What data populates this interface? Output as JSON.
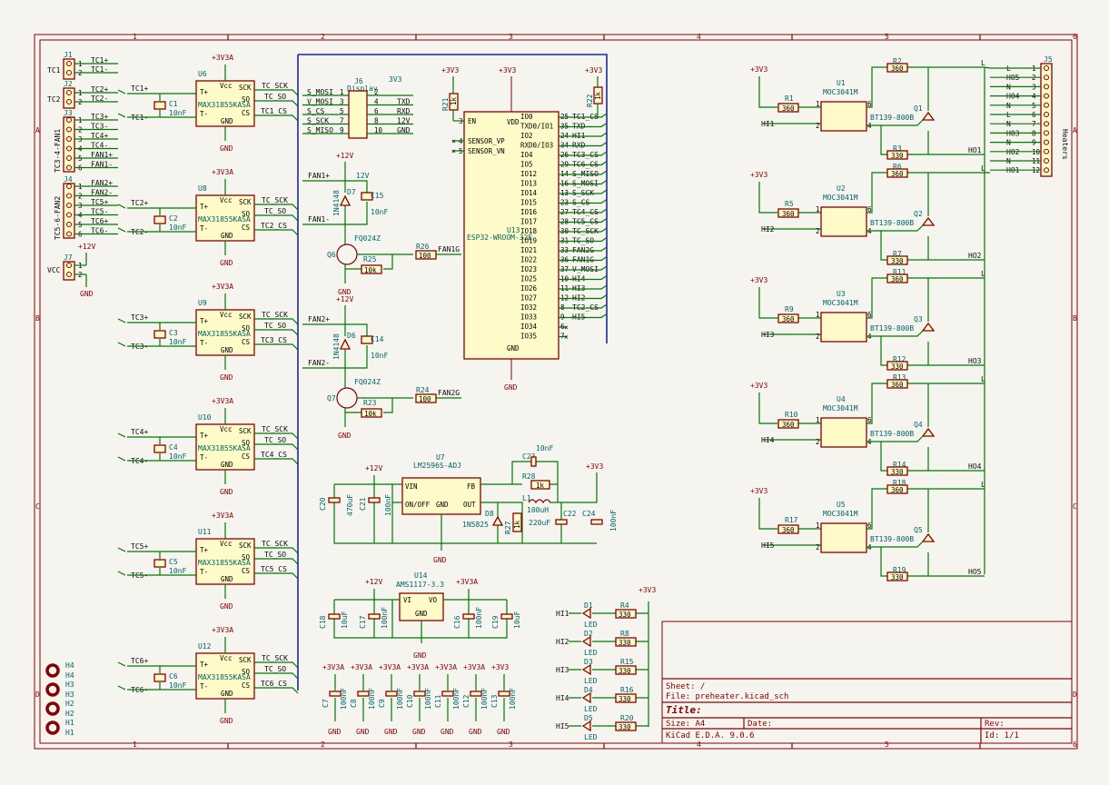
{
  "title_block": {
    "sheet": "Sheet: /",
    "file": "File: preheater.kicad_sch",
    "title": "Title:",
    "size": "Size: A4",
    "date": "Date:",
    "rev": "Rev:",
    "tool": "KiCad E.D.A. 9.0.6",
    "id": "Id: 1/1"
  },
  "frame": {
    "cols": [
      "1",
      "2",
      "3",
      "4",
      "5",
      "6"
    ],
    "rows": [
      "A",
      "B",
      "C",
      "D"
    ]
  },
  "power": {
    "p3v3a": "+3V3A",
    "p3v3": "+3V3",
    "p12v": "+12V",
    "gnd": "GND",
    "v12": "12V"
  },
  "connectors": {
    "j1": {
      "ref": "J1",
      "side": "TC1",
      "pins": [
        "TC1+",
        "TC1-"
      ]
    },
    "j2": {
      "ref": "J2",
      "side": "TC2",
      "pins": [
        "TC2+",
        "TC2-"
      ]
    },
    "j3": {
      "ref": "J3",
      "side": "TC3-4-FAN1",
      "pins": [
        "TC3+",
        "TC3-",
        "TC4+",
        "TC4-",
        "FAN1+",
        "FAN1-"
      ]
    },
    "j4": {
      "ref": "J4",
      "side": "TC5-6-FAN2",
      "pins": [
        "FAN2+",
        "FAN2-",
        "TC5+",
        "TC5-",
        "TC6+",
        "TC6-"
      ]
    },
    "j7": {
      "ref": "J7",
      "side": "VCC"
    },
    "j5": {
      "ref": "J5",
      "side": "Heaters",
      "pins": [
        "L",
        "HO5",
        "N",
        "HO4",
        "N",
        "L",
        "N",
        "HO3",
        "N",
        "HO2",
        "N",
        "HO1"
      ]
    }
  },
  "max": [
    {
      "ref": "U6",
      "cap": "C1",
      "tp": "TC1+",
      "tm": "TC1-",
      "cs": "TC1_CS"
    },
    {
      "ref": "U8",
      "cap": "C2",
      "tp": "TC2+",
      "tm": "TC2-",
      "cs": "TC2_CS"
    },
    {
      "ref": "U9",
      "cap": "C3",
      "tp": "TC3+",
      "tm": "TC3-",
      "cs": "TC3_CS"
    },
    {
      "ref": "U10",
      "cap": "C4",
      "tp": "TC4+",
      "tm": "TC4-",
      "cs": "TC4_CS"
    },
    {
      "ref": "U11",
      "cap": "C5",
      "tp": "TC5+",
      "tm": "TC5-",
      "cs": "TC5_CS"
    },
    {
      "ref": "U12",
      "cap": "C6",
      "tp": "TC6+",
      "tm": "TC6-",
      "cs": "TC6_CS"
    }
  ],
  "max_common": {
    "part": "MAX31855KASA",
    "cap_val": "10nF",
    "pins_left": [
      "T+",
      "T-"
    ],
    "pins_right": [
      "SCK",
      "SO",
      "CS"
    ],
    "vcc": "Vcc",
    "gnd": "GND",
    "sck_net": "TC_SCK",
    "so_net": "TC_SO"
  },
  "display": {
    "ref": "J6",
    "name": "Display",
    "left": [
      "S_MOSI",
      "V_MOSI",
      "S_CS",
      "S_SCK",
      "S_MISO"
    ],
    "right": [
      "TXD",
      "RXD",
      "12V",
      "GND"
    ],
    "label_3v3": "3V3"
  },
  "esp": {
    "ref": "U13",
    "part": "ESP32-WROOM-32E",
    "left_pins": [
      "EN",
      "SENSOR_VP",
      "SENSOR_VN"
    ],
    "left_nums": [
      "3",
      "4",
      "5"
    ],
    "right_pins": [
      "IO0",
      "TXD0/IO1",
      "IO2",
      "RXD0/IO3",
      "IO4",
      "IO5",
      "IO12",
      "IO13",
      "IO14",
      "IO15",
      "IO16",
      "IO17",
      "IO18",
      "IO19",
      "IO21",
      "IO22",
      "IO23",
      "IO25",
      "IO26",
      "IO27",
      "IO32",
      "IO33",
      "IO34",
      "IO35"
    ],
    "right_nums": [
      "25",
      "35",
      "24",
      "34",
      "26",
      "29",
      "14",
      "16",
      "13",
      "23",
      "27",
      "28",
      "30",
      "31",
      "33",
      "36",
      "37",
      "10",
      "11",
      "12",
      "8",
      "9",
      "6",
      "7"
    ],
    "right_nets": [
      "TC1_CS",
      "TXD",
      "HI1",
      "RXD",
      "TC3_CS",
      "TC6_CS",
      "S_MISO",
      "S_MOSI",
      "S_SCK",
      "S_CS",
      "TC4_CS",
      "TC5_CS",
      "TC_SCK",
      "TC_SO",
      "FAN2G",
      "FAN1G",
      "V_MOSI",
      "HI4",
      "HI3",
      "HI2",
      "TC2_CS",
      "HI5",
      "",
      ""
    ],
    "vdd": "VDD",
    "gnd": "GND",
    "r21": "R21",
    "r21v": "1k",
    "r22": "R22",
    "r22v": "1k"
  },
  "fans": [
    {
      "plus": "FAN1+",
      "minus": "FAN1-",
      "d": "D7",
      "c": "C15",
      "q": "Q6",
      "rg": "R26",
      "rp": "R25",
      "gnet": "FAN1G"
    },
    {
      "plus": "FAN2+",
      "minus": "FAN2-",
      "d": "D6",
      "c": "C14",
      "q": "Q7",
      "rg": "R24",
      "rp": "R23",
      "gnet": "FAN2G"
    }
  ],
  "fan_common": {
    "dval": "1N4148",
    "cval": "10nF",
    "qval": "FQ024Z",
    "rgval": "100",
    "rpval": "10k"
  },
  "buck": {
    "ref": "U7",
    "part": "LM2596S-ADJ",
    "pins": [
      "VIN",
      "ON/OFF",
      "GND",
      "FB",
      "OUT"
    ],
    "c20": "C20",
    "c20v": "470uF",
    "c21": "C21",
    "c21v": "100nF",
    "c23": "C23",
    "c23v": "10nF",
    "r28": "R28",
    "r28v": "1k",
    "l1": "L1",
    "l1v": "100uH",
    "d8": "D8",
    "d8v": "1N5825",
    "r27": "R27",
    "r27v": "1k",
    "c22": "C22",
    "c22v": "220uF",
    "c24": "C24",
    "c24v": "100nF"
  },
  "ldo": {
    "ref": "U14",
    "part": "AMS1117-3.3",
    "pins": [
      "VI",
      "VO",
      "GND"
    ],
    "caps": [
      {
        "ref": "C18",
        "val": "10uF"
      },
      {
        "ref": "C17",
        "val": "100nF"
      },
      {
        "ref": "C16",
        "val": "100nF"
      },
      {
        "ref": "C19",
        "val": "10uF"
      }
    ]
  },
  "decoupling": [
    {
      "ref": "C7",
      "val": "100nF",
      "rail": "+3V3A"
    },
    {
      "ref": "C8",
      "val": "100nF",
      "rail": "+3V3A"
    },
    {
      "ref": "C9",
      "val": "100nF",
      "rail": "+3V3A"
    },
    {
      "ref": "C10",
      "val": "100nF",
      "rail": "+3V3A"
    },
    {
      "ref": "C11",
      "val": "100nF",
      "rail": "+3V3A"
    },
    {
      "ref": "C12",
      "val": "100nF",
      "rail": "+3V3A"
    },
    {
      "ref": "C13",
      "val": "100nF",
      "rail": "+3V3"
    }
  ],
  "leds": [
    {
      "net": "HI1",
      "d": "D1",
      "r": "R4"
    },
    {
      "net": "HI2",
      "d": "D2",
      "r": "R8"
    },
    {
      "net": "HI3",
      "d": "D3",
      "r": "R15"
    },
    {
      "net": "HI4",
      "d": "D4",
      "r": "R16"
    },
    {
      "net": "HI5",
      "d": "D5",
      "r": "R20"
    }
  ],
  "led_common": {
    "dval": "LED",
    "rval": "330"
  },
  "triacs": [
    {
      "u": "U1",
      "r_in": "R1",
      "r_g": "R2",
      "r_s": "R3",
      "q": "Q1",
      "hi": "HI1",
      "ho": "HO1"
    },
    {
      "u": "U2",
      "r_in": "R5",
      "r_g": "R6",
      "r_s": "R7",
      "q": "Q2",
      "hi": "HI2",
      "ho": "HO2"
    },
    {
      "u": "U3",
      "r_in": "R9",
      "r_g": "R11",
      "r_s": "R12",
      "q": "Q3",
      "hi": "HI3",
      "ho": "HO3"
    },
    {
      "u": "U4",
      "r_in": "R10",
      "r_g": "R13",
      "r_s": "R14",
      "q": "Q4",
      "hi": "HI4",
      "ho": "HO4"
    },
    {
      "u": "U5",
      "r_in": "R17",
      "r_g": "R18",
      "r_s": "R19",
      "q": "Q5",
      "hi": "HI5",
      "ho": "HO5"
    }
  ],
  "triac_common": {
    "opto": "MOC3041M",
    "triac": "BT139-800B",
    "rin_val": "360",
    "rg_val": "360",
    "rs_val": "330",
    "l": "L"
  },
  "holes": [
    "H4",
    "H3",
    "H2",
    "H1"
  ]
}
